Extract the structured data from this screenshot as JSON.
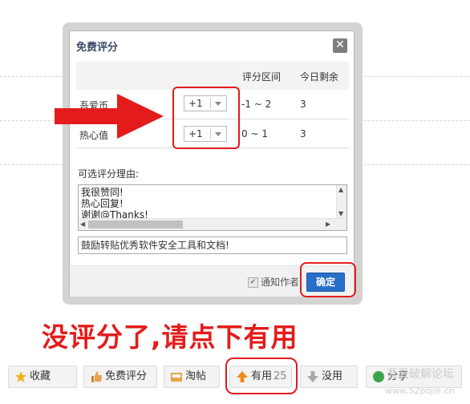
{
  "dialog": {
    "title": "免费评分",
    "close_glyph": "✕",
    "columns": {
      "range": "评分区间",
      "remaining": "今日剩余"
    },
    "rows": [
      {
        "label": "吾爱币",
        "selected": "+1",
        "range": "-1 ~ 2",
        "remaining": "3"
      },
      {
        "label": "热心值",
        "selected": "+1",
        "range": "0 ~ 1",
        "remaining": "3"
      }
    ],
    "reason_label": "可选评分理由:",
    "reason_options": [
      "我很赞同!",
      "热心回复!",
      "谢谢@Thanks!"
    ],
    "reason_input": "鼓励转贴优秀软件安全工具和文档!",
    "notify_label": "通知作者",
    "confirm_label": "确定"
  },
  "annotation": {
    "caption": "没评分了,请点下有用",
    "color": "#e41b1b"
  },
  "action_bar": {
    "favorite": "收藏",
    "rate": "免费评分",
    "digg": "淘帖",
    "useful": "有用",
    "useful_count": "25",
    "useless": "没用",
    "share": "分享",
    "watermark": "吾爱破解论坛",
    "watermark_url": "www.52pojie.cn"
  }
}
